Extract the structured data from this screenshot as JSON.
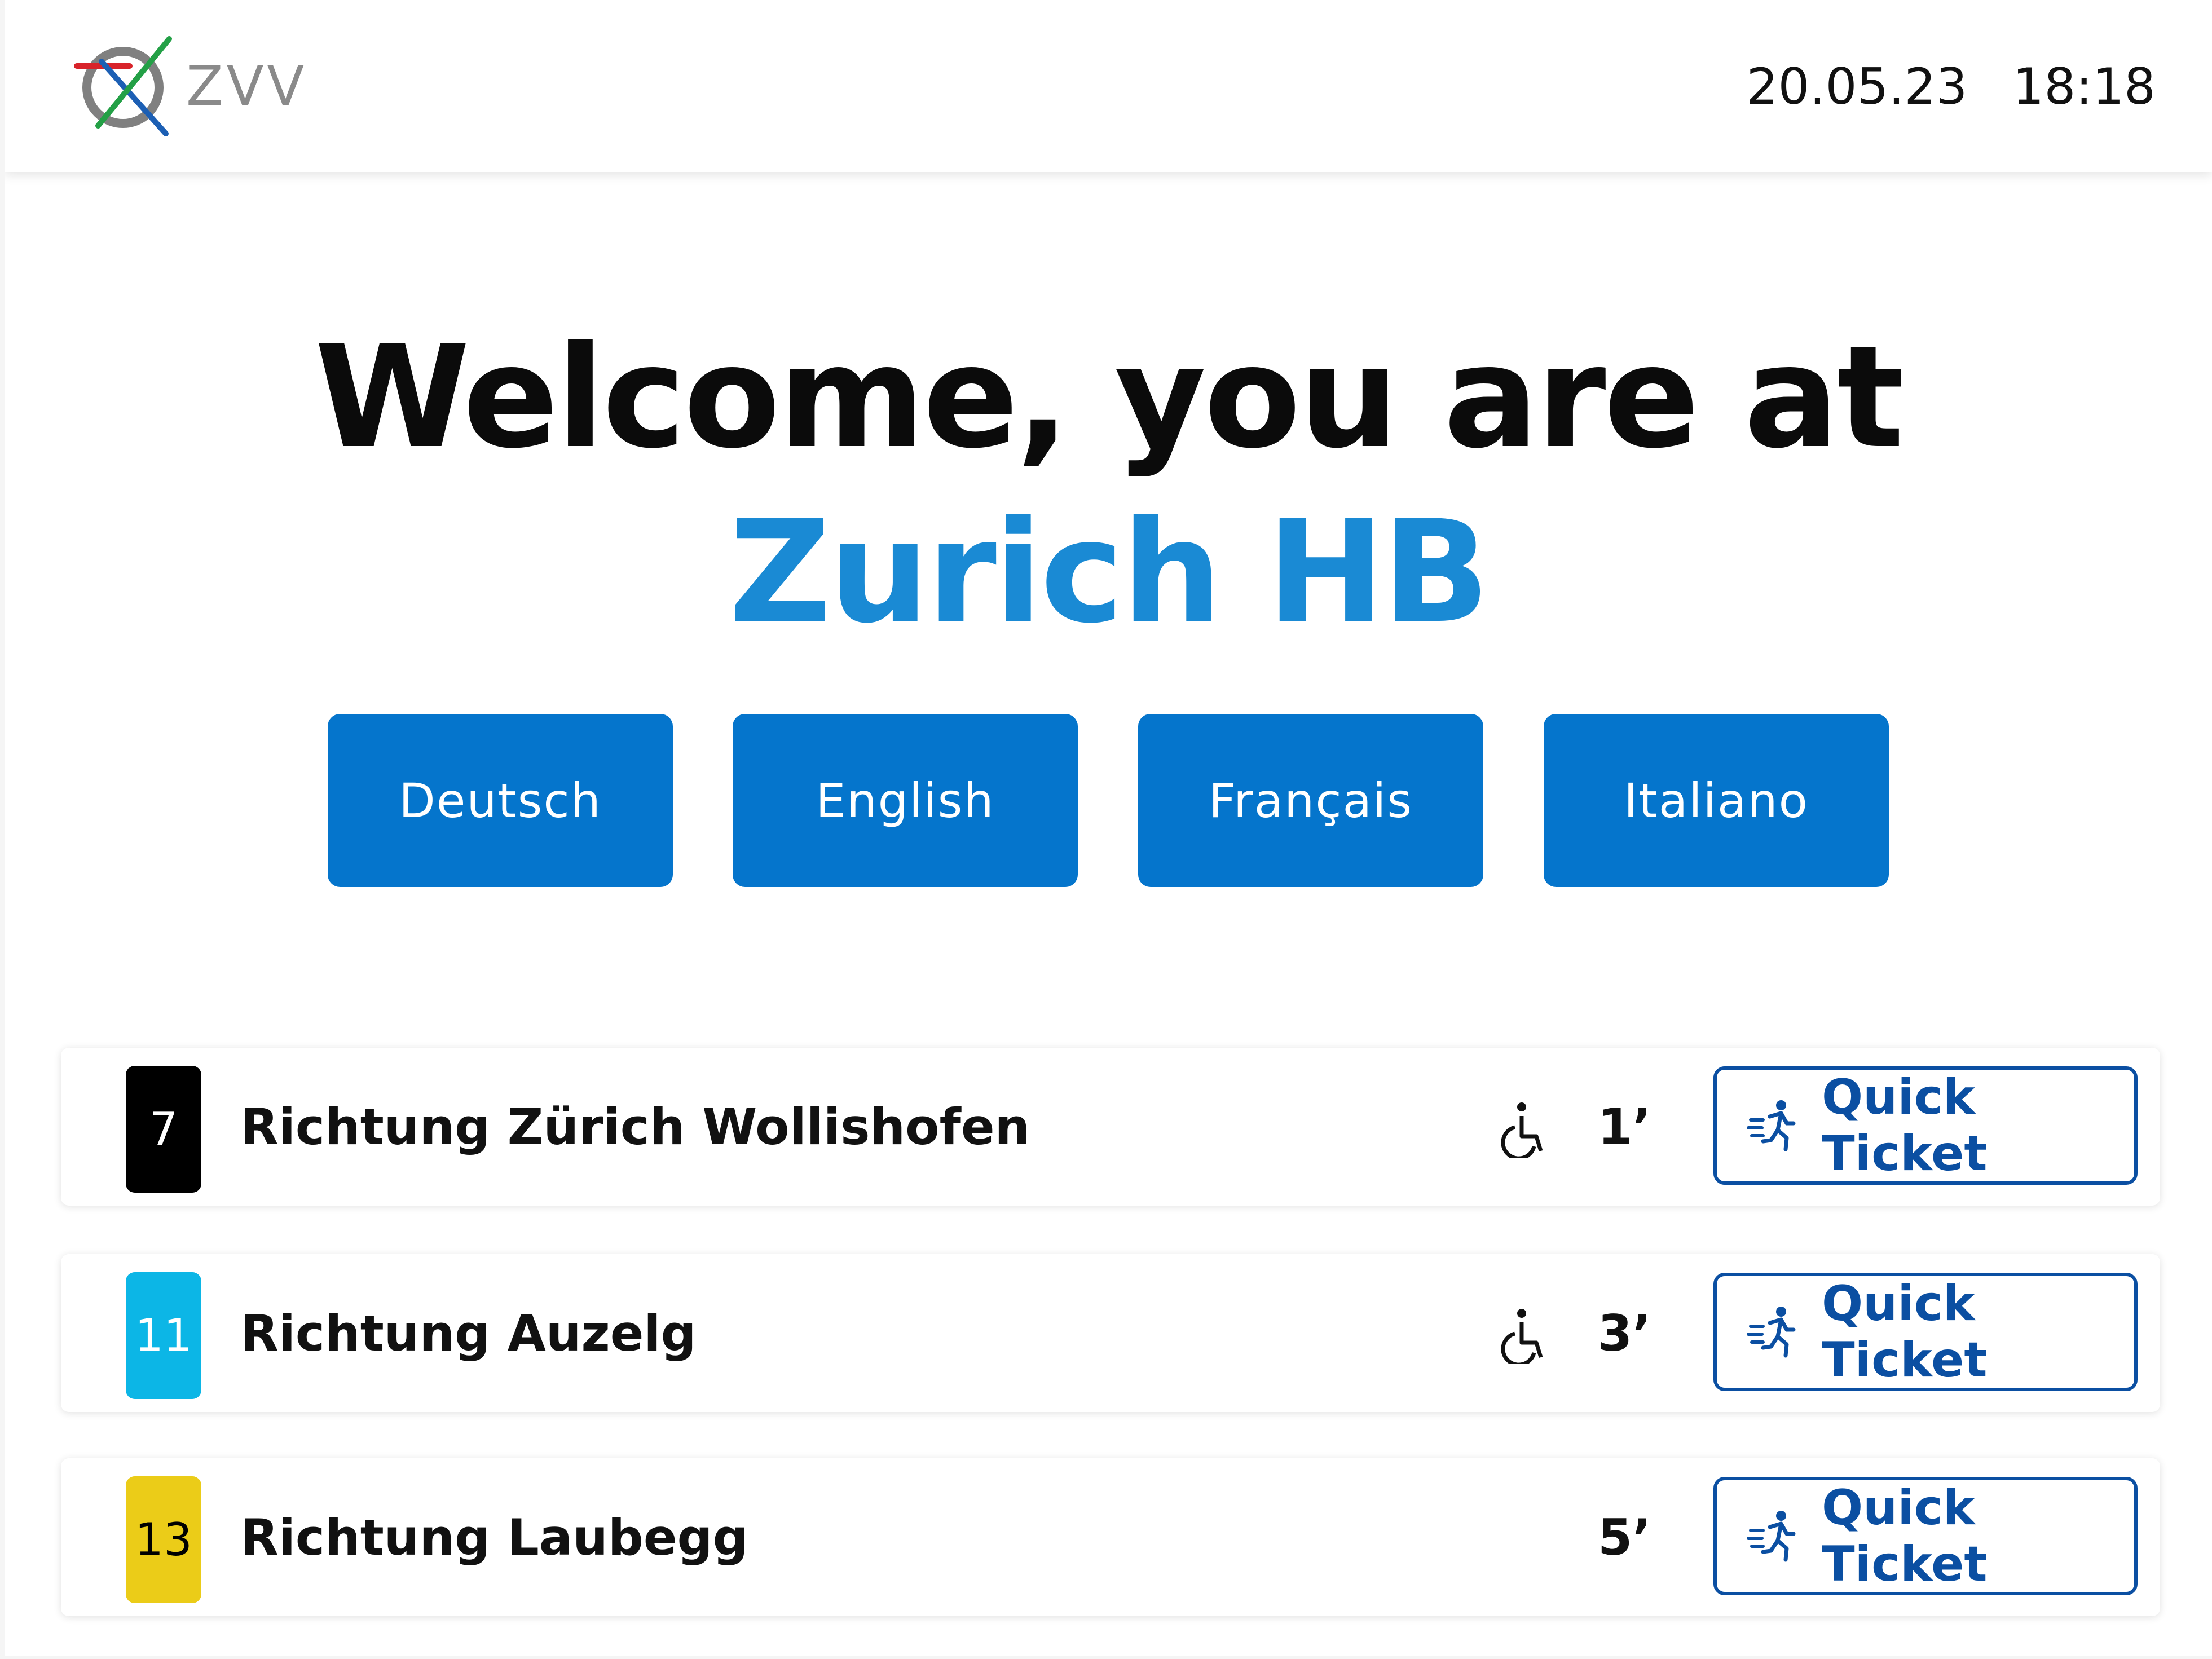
{
  "header": {
    "logo_text": "ZVV",
    "date": "20.05.23",
    "time": "18:18"
  },
  "welcome": {
    "line1": "Welcome, you are at",
    "station": "Zurich HB"
  },
  "languages": [
    "Deutsch",
    "English",
    "Français",
    "Italiano"
  ],
  "departures": [
    {
      "line": "7",
      "line_bg": "#000000",
      "line_fg": "#ffffff",
      "destination": "Richtung Zürich Wollishofen",
      "accessible": true,
      "minutes": "1’",
      "button_label": "Quick Ticket"
    },
    {
      "line": "11",
      "line_bg": "#0cb6e6",
      "line_fg": "#ffffff",
      "destination": "Richtung Auzelg",
      "accessible": true,
      "minutes": "3’",
      "button_label": "Quick Ticket"
    },
    {
      "line": "13",
      "line_bg": "#ebcc18",
      "line_fg": "#000000",
      "destination": "Richtung Laubegg",
      "accessible": false,
      "minutes": "5’",
      "button_label": "Quick Ticket"
    }
  ],
  "icons": {
    "accessibility": "wheelchair-icon",
    "quick_ticket": "running-person-icon",
    "logo": "zvv-logo"
  },
  "colors": {
    "accent": "#0575cc",
    "station_text": "#1a8ad4",
    "outline_button": "#0b4fa2"
  }
}
